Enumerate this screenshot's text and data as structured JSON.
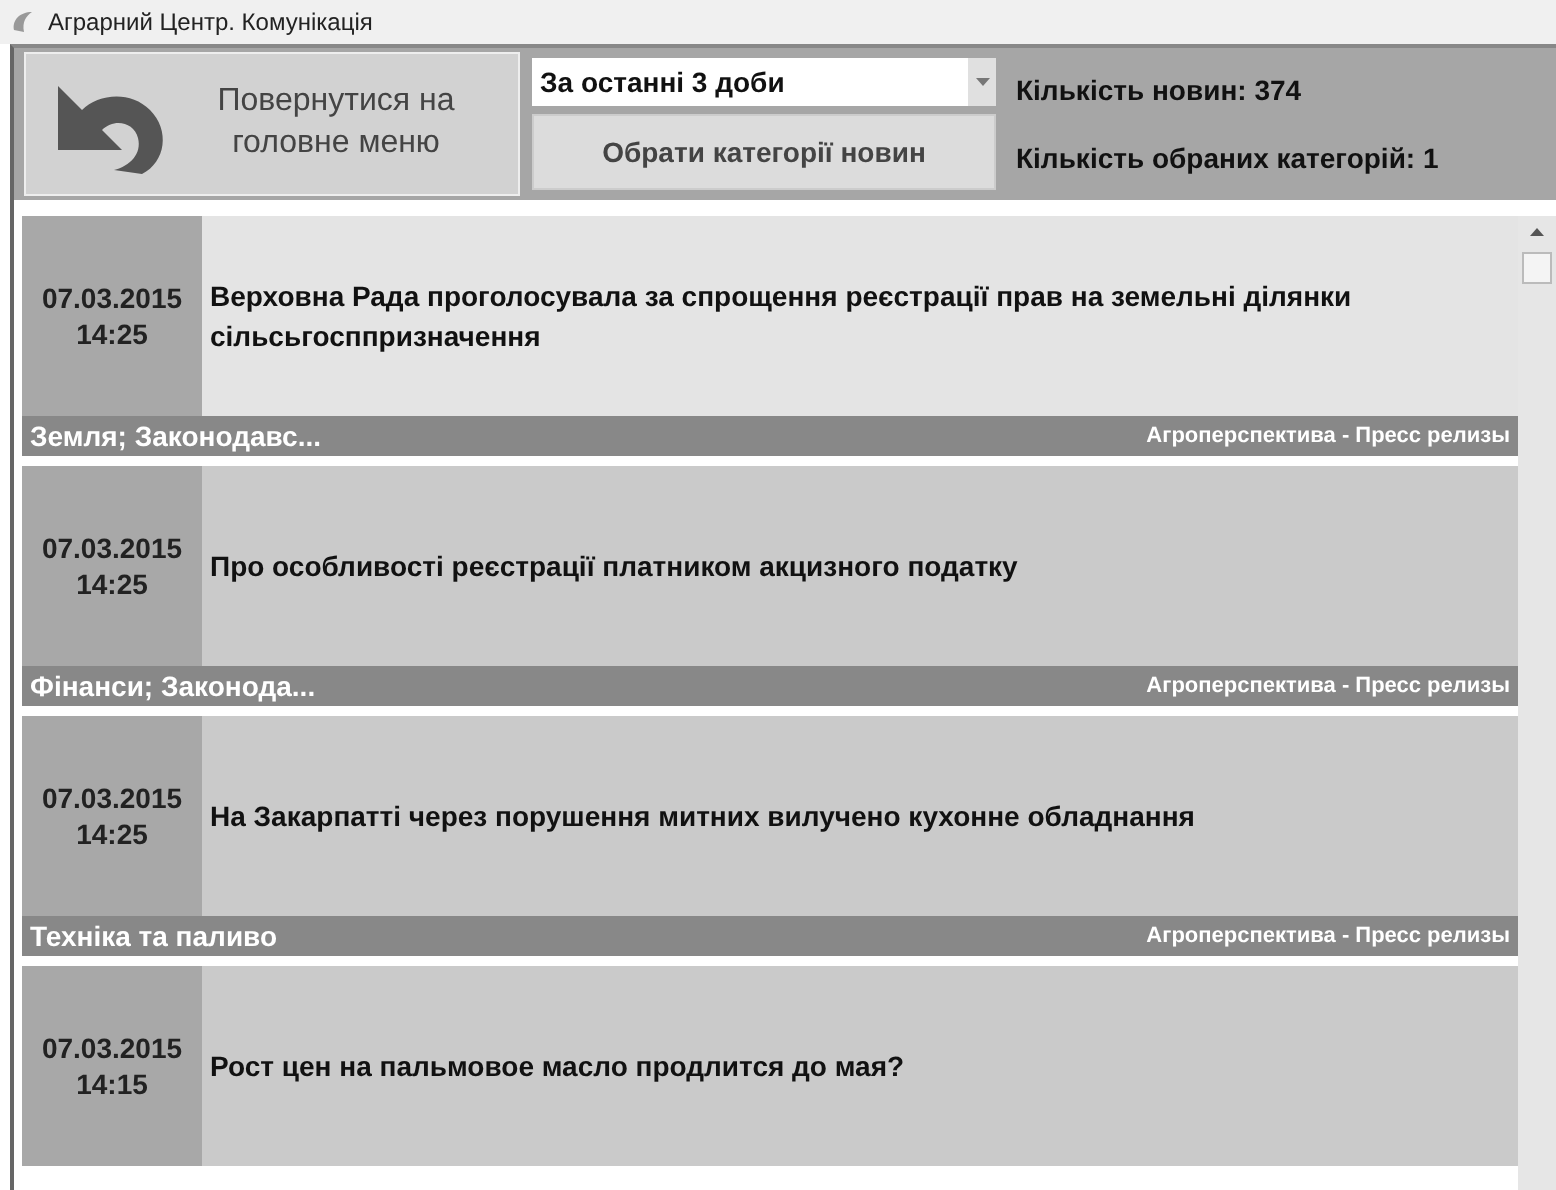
{
  "window": {
    "title": "Аграрний Центр. Комунікація"
  },
  "toolbar": {
    "back_button": "Повернутися на головне меню",
    "period": {
      "value": "За останні 3 доби"
    },
    "categories_button": "Обрати категорії новин",
    "news_count": "Кількість новин: 374",
    "categories_count": "Кількість обраних категорій: 1"
  },
  "news": [
    {
      "date": "07.03.2015 14:25",
      "title": "Верховна Рада проголосувала за спрощення реєстрації прав на земельні ділянки сільсьгосппризначення",
      "categories": "Земля; Законодавс...",
      "source": "Агроперспектива - Пресс релизы",
      "selected": true
    },
    {
      "date": "07.03.2015 14:25",
      "title": "Про особливості реєстрації платником акцизного податку",
      "categories": "Фінанси; Законода...",
      "source": "Агроперспектива - Пресс релизы",
      "selected": false
    },
    {
      "date": "07.03.2015 14:25",
      "title": "На Закарпатті через порушення митних вилучено кухонне обладнання",
      "categories": "Техніка та паливо",
      "source": "Агроперспектива - Пресс релизы",
      "selected": false
    },
    {
      "date": "07.03.2015 14:15",
      "title": "Рост цен на пальмовое масло продлится до мая?",
      "selected": false
    }
  ]
}
